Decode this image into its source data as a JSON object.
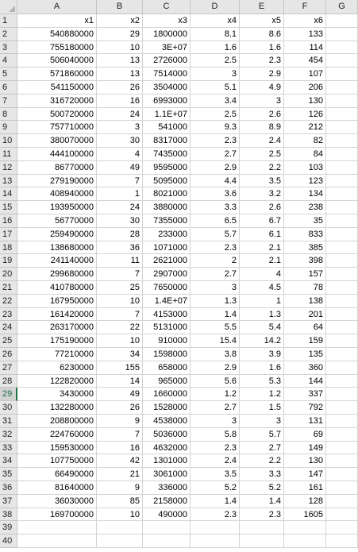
{
  "columns": [
    "A",
    "B",
    "C",
    "D",
    "E",
    "F",
    "G"
  ],
  "header_row": [
    "x1",
    "x2",
    "x3",
    "x4",
    "x5",
    "x6",
    ""
  ],
  "rows": [
    [
      "540880000",
      "29",
      "1800000",
      "8.1",
      "8.6",
      "133"
    ],
    [
      "755180000",
      "10",
      "3E+07",
      "1.6",
      "1.6",
      "114"
    ],
    [
      "506040000",
      "13",
      "2726000",
      "2.5",
      "2.3",
      "454"
    ],
    [
      "571860000",
      "13",
      "7514000",
      "3",
      "2.9",
      "107"
    ],
    [
      "541150000",
      "26",
      "3504000",
      "5.1",
      "4.9",
      "206"
    ],
    [
      "316720000",
      "16",
      "6993000",
      "3.4",
      "3",
      "130"
    ],
    [
      "500720000",
      "24",
      "1.1E+07",
      "2.5",
      "2.6",
      "126"
    ],
    [
      "757710000",
      "3",
      "541000",
      "9.3",
      "8.9",
      "212"
    ],
    [
      "380070000",
      "30",
      "8317000",
      "2.3",
      "2.4",
      "82"
    ],
    [
      "444100000",
      "4",
      "7435000",
      "2.7",
      "2.5",
      "84"
    ],
    [
      "86770000",
      "49",
      "9595000",
      "2.9",
      "2.2",
      "103"
    ],
    [
      "279190000",
      "7",
      "5095000",
      "4.4",
      "3.5",
      "123"
    ],
    [
      "408940000",
      "1",
      "8021000",
      "3.6",
      "3.2",
      "134"
    ],
    [
      "193950000",
      "24",
      "3880000",
      "3.3",
      "2.6",
      "238"
    ],
    [
      "56770000",
      "30",
      "7355000",
      "6.5",
      "6.7",
      "35"
    ],
    [
      "259490000",
      "28",
      "233000",
      "5.7",
      "6.1",
      "833"
    ],
    [
      "138680000",
      "36",
      "1071000",
      "2.3",
      "2.1",
      "385"
    ],
    [
      "241140000",
      "11",
      "2621000",
      "2",
      "2.1",
      "398"
    ],
    [
      "299680000",
      "7",
      "2907000",
      "2.7",
      "4",
      "157"
    ],
    [
      "410780000",
      "25",
      "7650000",
      "3",
      "4.5",
      "78"
    ],
    [
      "167950000",
      "10",
      "1.4E+07",
      "1.3",
      "1",
      "138"
    ],
    [
      "161420000",
      "7",
      "4153000",
      "1.4",
      "1.3",
      "201"
    ],
    [
      "263170000",
      "22",
      "5131000",
      "5.5",
      "5.4",
      "64"
    ],
    [
      "175190000",
      "10",
      "910000",
      "15.4",
      "14.2",
      "159"
    ],
    [
      "77210000",
      "34",
      "1598000",
      "3.8",
      "3.9",
      "135"
    ],
    [
      "6230000",
      "155",
      "658000",
      "2.9",
      "1.6",
      "360"
    ],
    [
      "122820000",
      "14",
      "965000",
      "5.6",
      "5.3",
      "144"
    ],
    [
      "3430000",
      "49",
      "1660000",
      "1.2",
      "1.2",
      "337"
    ],
    [
      "132280000",
      "26",
      "1528000",
      "2.7",
      "1.5",
      "792"
    ],
    [
      "208800000",
      "9",
      "4538000",
      "3",
      "3",
      "131"
    ],
    [
      "224760000",
      "7",
      "5036000",
      "5.8",
      "5.7",
      "69"
    ],
    [
      "159530000",
      "16",
      "4632000",
      "2.3",
      "2.7",
      "149"
    ],
    [
      "107750000",
      "42",
      "1301000",
      "2.4",
      "2.2",
      "130"
    ],
    [
      "66490000",
      "21",
      "3061000",
      "3.5",
      "3.3",
      "147"
    ],
    [
      "81640000",
      "9",
      "336000",
      "5.2",
      "5.2",
      "161"
    ],
    [
      "36030000",
      "85",
      "2158000",
      "1.4",
      "1.4",
      "128"
    ],
    [
      "169700000",
      "10",
      "490000",
      "2.3",
      "2.3",
      "1605"
    ]
  ],
  "row_count": 40,
  "active_row": 29,
  "accent_color": "#217346"
}
